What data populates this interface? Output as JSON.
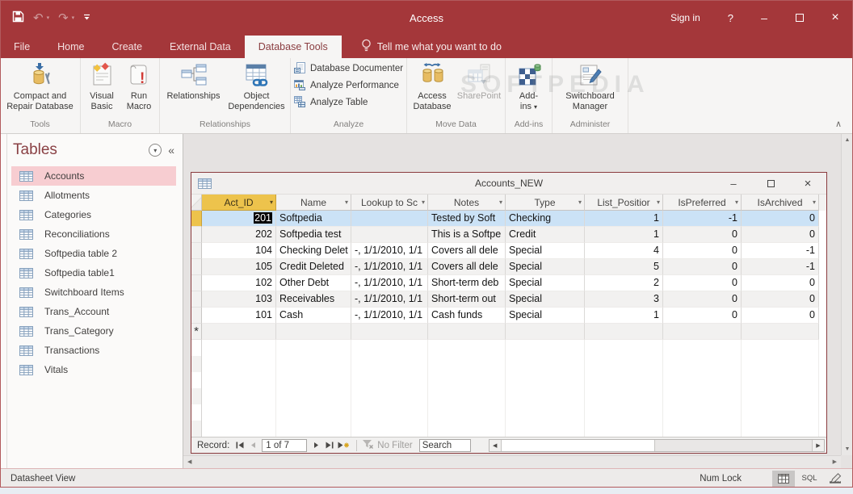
{
  "titlebar": {
    "app_title": "Access",
    "sign_in_label": "Sign in",
    "help_label": "?"
  },
  "ribbon_tabs": {
    "file": "File",
    "home": "Home",
    "create": "Create",
    "external_data": "External Data",
    "database_tools": "Database Tools",
    "tell_me": "Tell me what you want to do"
  },
  "ribbon": {
    "tools": {
      "label": "Tools",
      "compact_repair": "Compact and Repair Database"
    },
    "macro": {
      "label": "Macro",
      "visual_basic": "Visual Basic",
      "run_macro": "Run Macro"
    },
    "relationships": {
      "label": "Relationships",
      "relationships_btn": "Relationships",
      "object_dependencies": "Object Dependencies"
    },
    "analyze": {
      "label": "Analyze",
      "database_documenter": "Database Documenter",
      "analyze_performance": "Analyze Performance",
      "analyze_table": "Analyze Table"
    },
    "move_data": {
      "label": "Move Data",
      "access_database": "Access Database",
      "sharepoint": "SharePoint"
    },
    "addins": {
      "label": "Add-ins",
      "addins_btn": "Add-ins"
    },
    "administer": {
      "label": "Administer",
      "switchboard_manager": "Switchboard Manager"
    }
  },
  "watermark": "SOFTPEDIA",
  "sidebar": {
    "title": "Tables",
    "items": [
      {
        "label": "Accounts",
        "selected": true
      },
      {
        "label": "Allotments"
      },
      {
        "label": "Categories"
      },
      {
        "label": "Reconciliations"
      },
      {
        "label": "Softpedia table 2"
      },
      {
        "label": "Softpedia table1"
      },
      {
        "label": "Switchboard Items"
      },
      {
        "label": "Trans_Account"
      },
      {
        "label": "Trans_Category"
      },
      {
        "label": "Transactions"
      },
      {
        "label": "Vitals"
      }
    ]
  },
  "datasheet": {
    "window_title": "Accounts_NEW",
    "columns": [
      "Act_ID",
      "Name",
      "Lookup to Sc",
      "Notes",
      "Type",
      "List_Positior",
      "IsPreferred",
      "IsArchived"
    ],
    "rows": [
      {
        "selected": true,
        "cells": [
          "201",
          "Softpedia",
          "",
          "Tested by Soft",
          "Checking",
          "1",
          "-1",
          "0"
        ]
      },
      {
        "cells": [
          "202",
          "Softpedia test",
          "",
          "This is a Softpe",
          "Credit",
          "1",
          "0",
          "0"
        ]
      },
      {
        "cells": [
          "104",
          "Checking Delet",
          "-, 1/1/2010, 1/1",
          "Covers all dele",
          "Special",
          "4",
          "0",
          "-1"
        ]
      },
      {
        "cells": [
          "105",
          "Credit Deleted",
          "-, 1/1/2010, 1/1",
          "Covers all dele",
          "Special",
          "5",
          "0",
          "-1"
        ]
      },
      {
        "cells": [
          "102",
          "Other Debt",
          "-, 1/1/2010, 1/1",
          "Short-term deb",
          "Special",
          "2",
          "0",
          "0"
        ]
      },
      {
        "cells": [
          "103",
          "Receivables",
          "-, 1/1/2010, 1/1",
          "Short-term out",
          "Special",
          "3",
          "0",
          "0"
        ]
      },
      {
        "cells": [
          "101",
          "Cash",
          "-, 1/1/2010, 1/1",
          "Cash funds",
          "Special",
          "1",
          "0",
          "0"
        ]
      }
    ],
    "new_record_marker": "*",
    "record_bar": {
      "record_label": "Record:",
      "position": "1 of 7",
      "no_filter_label": "No Filter",
      "search_value": "Search"
    }
  },
  "statusbar": {
    "view_label": "Datasheet View",
    "num_lock_label": "Num Lock",
    "sql_label": "SQL"
  },
  "icons": {
    "dropdown": "▾",
    "collapse_pane": "«",
    "undo": "↶",
    "redo": "↷",
    "minimize": "–",
    "close": "×",
    "scroll_up": "▲",
    "scroll_down": "▼",
    "scroll_left": "◀",
    "scroll_right": "▶",
    "ribbon_collapse": "∧"
  },
  "colors": {
    "accent_red": "#a4373a",
    "selected_row_blue": "#cbe2f6",
    "selected_header_amber": "#edc34c",
    "selected_nav_pink": "#f7cdd1"
  }
}
